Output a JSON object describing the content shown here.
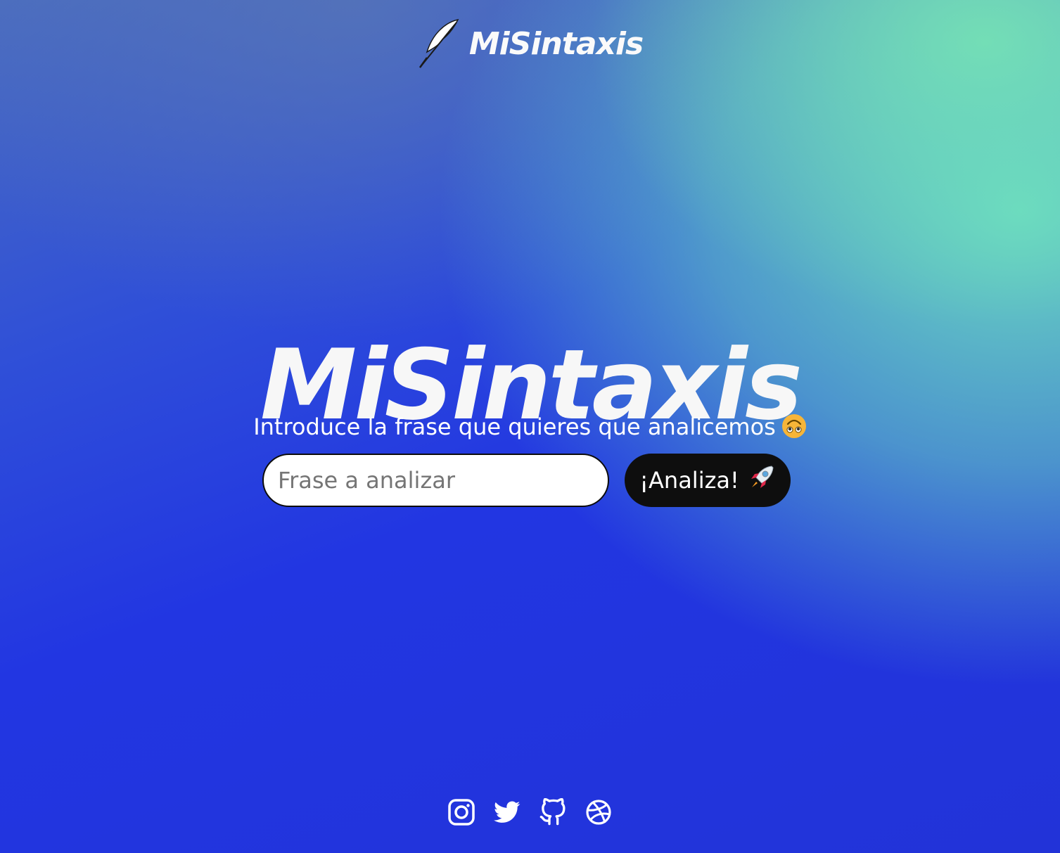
{
  "header": {
    "logo_icon": "quill-feather-icon",
    "brand": "MiSintaxis"
  },
  "hero": {
    "title": "MiSintaxis",
    "subtitle": "Introduce la frase que quieres que analicemos",
    "subtitle_emoji": "upside-down-face-emoji"
  },
  "form": {
    "input_placeholder": "Frase a analizar",
    "input_value": "",
    "button_label": "¡Analiza!",
    "button_icon": "rocket-emoji"
  },
  "footer": {
    "socials": [
      {
        "name": "instagram-icon"
      },
      {
        "name": "twitter-icon"
      },
      {
        "name": "github-icon"
      },
      {
        "name": "dribbble-icon"
      }
    ]
  },
  "colors": {
    "gradient_blue": "#2236e2",
    "gradient_green": "#6ee1be",
    "button_bg": "#0e0e0e",
    "text": "#ffffff"
  }
}
